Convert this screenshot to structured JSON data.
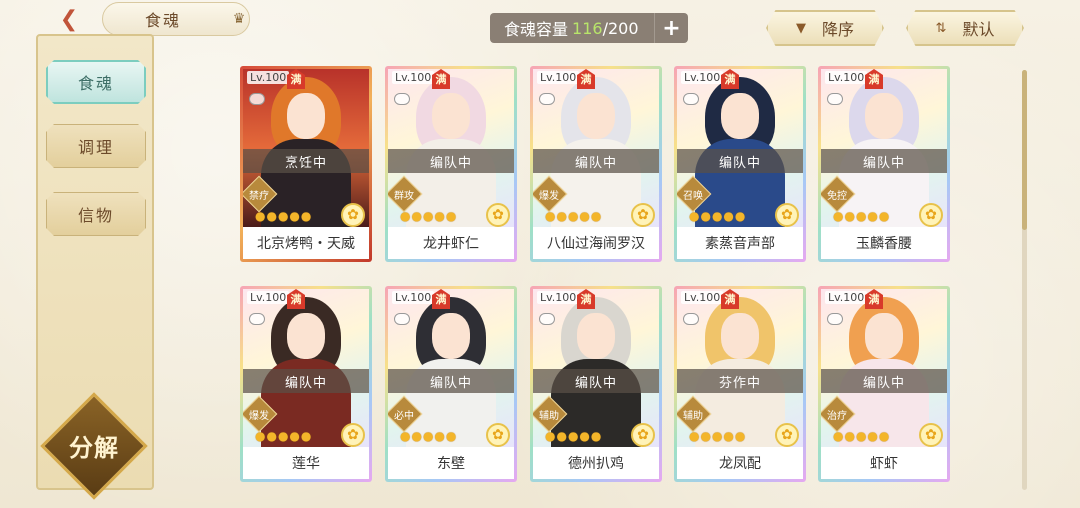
{
  "header": {
    "back_icon": "back-arrow-icon",
    "title": "食魂",
    "capacity_label": "食魂容量",
    "capacity_current": "116",
    "capacity_sep_max": "/200",
    "add_icon": "plus-icon"
  },
  "sort": {
    "order_label": "降序",
    "order_icon": "triangle-down-icon",
    "mode_label": "默认",
    "mode_icon": "sort-arrows-icon"
  },
  "sidebar": {
    "items": [
      {
        "label": "食魂",
        "active": true
      },
      {
        "label": "调理",
        "active": false
      },
      {
        "label": "信物",
        "active": false
      }
    ],
    "decompose_label": "分解"
  },
  "cards": [
    {
      "level": "Lv.100",
      "full": "满",
      "status": "烹饪中",
      "role": "禁疗",
      "stars": "●●●●●",
      "name": "北京烤鸭・天威",
      "frame": "red",
      "hair": "#e0782a",
      "outfit": "#2a2226"
    },
    {
      "level": "Lv.100",
      "full": "满",
      "status": "编队中",
      "role": "群攻",
      "stars": "●●●●●",
      "name": "龙井虾仁",
      "frame": "rainbow",
      "hair": "#f1d9e2",
      "outfit": "#f3efe8"
    },
    {
      "level": "Lv.100",
      "full": "满",
      "status": "编队中",
      "role": "爆发",
      "stars": "●●●●●",
      "name": "八仙过海闹罗汉",
      "frame": "rainbow",
      "hair": "#e4e4ea",
      "outfit": "#f5f2ec"
    },
    {
      "level": "Lv.100",
      "full": "满",
      "status": "编队中",
      "role": "召唤",
      "stars": "●●●●●",
      "name": "素蒸音声部",
      "frame": "rainbow",
      "hair": "#1f2a44",
      "outfit": "#2a4a8a"
    },
    {
      "level": "Lv.100",
      "full": "满",
      "status": "编队中",
      "role": "免控",
      "stars": "●●●●●",
      "name": "玉麟香腰",
      "frame": "rainbow",
      "hair": "#dcd8ec",
      "outfit": "#f7f3f5"
    },
    {
      "level": "Lv.100",
      "full": "满",
      "status": "编队中",
      "role": "爆发",
      "stars": "●●●●●",
      "name": "莲华",
      "frame": "rainbow",
      "hair": "#3a2a24",
      "outfit": "#7a2a22"
    },
    {
      "level": "Lv.100",
      "full": "满",
      "status": "编队中",
      "role": "必中",
      "stars": "●●●●●",
      "name": "东壁",
      "frame": "rainbow",
      "hair": "#2e2e34",
      "outfit": "#f1f1ee"
    },
    {
      "level": "Lv.100",
      "full": "满",
      "status": "编队中",
      "role": "辅助",
      "stars": "●●●●●",
      "name": "德州扒鸡",
      "frame": "rainbow",
      "hair": "#d9d6cf",
      "outfit": "#2c2a28"
    },
    {
      "level": "Lv.100",
      "full": "满",
      "status": "芬作中",
      "role": "辅助",
      "stars": "●●●●●",
      "name": "龙凤配",
      "frame": "rainbow",
      "hair": "#f0c46a",
      "outfit": "#f4ece0"
    },
    {
      "level": "Lv.100",
      "full": "满",
      "status": "编队中",
      "role": "治疗",
      "stars": "●●●●●",
      "name": "虾虾",
      "frame": "rainbow",
      "hair": "#f0a050",
      "outfit": "#f7e6ea"
    }
  ]
}
